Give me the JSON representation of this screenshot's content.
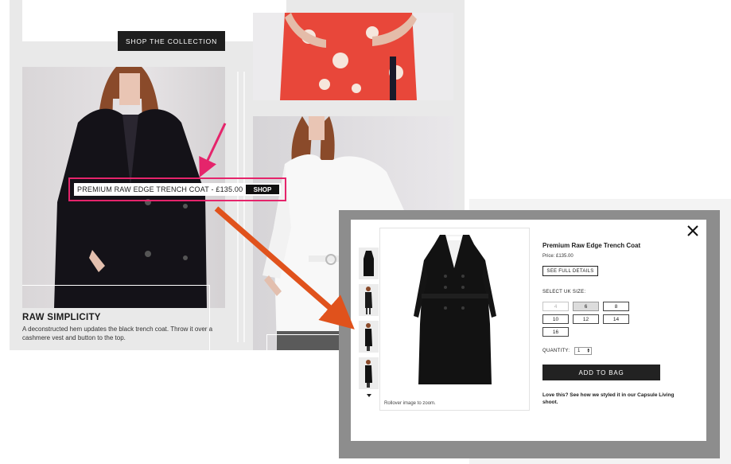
{
  "editorial": {
    "shop_collection_label": "SHOP THE COLLECTION",
    "caption_title": "RAW SIMPLICITY",
    "caption_text": "A deconstructed hem updates the black trench coat. Throw it over a cashmere vest and button to the top.",
    "product_tag": {
      "text": "PREMIUM RAW EDGE TRENCH COAT - £135.00",
      "shop_label": "SHOP"
    }
  },
  "modal": {
    "close_icon": "close-icon",
    "product_title": "Premium Raw Edge Trench Coat",
    "price": "Price: £135.00",
    "full_details_label": "SEE FULL DETAILS",
    "size_label": "SELECT UK SIZE:",
    "sizes": [
      {
        "label": "4",
        "state": "disabled"
      },
      {
        "label": "6",
        "state": "selected"
      },
      {
        "label": "8",
        "state": "available"
      },
      {
        "label": "10",
        "state": "available"
      },
      {
        "label": "12",
        "state": "available"
      },
      {
        "label": "14",
        "state": "available"
      },
      {
        "label": "16",
        "state": "available"
      }
    ],
    "quantity_label": "QUANTITY:",
    "quantity_value": "1",
    "add_to_bag_label": "ADD TO BAG",
    "styled_note": "Love this? See how we styled it in our Capsule Living shoot.",
    "zoom_note": "Rollover image to zoom."
  },
  "colors": {
    "highlight": "#e5246b",
    "arrow": "#e0521c",
    "button_dark": "#1e1e1e"
  }
}
